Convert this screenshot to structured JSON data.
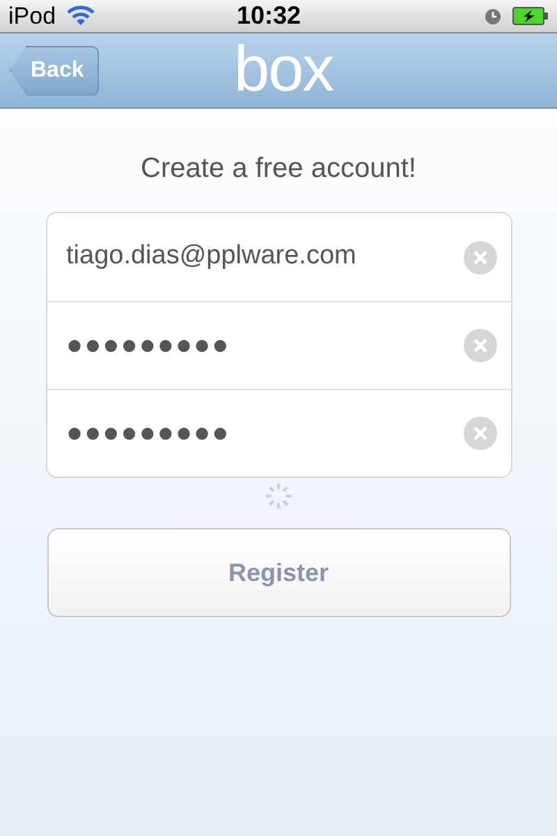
{
  "status_bar": {
    "carrier": "iPod",
    "time": "10:32"
  },
  "nav_bar": {
    "back": "Back",
    "logo": "box"
  },
  "heading": "Create a free account!",
  "fields": [
    {
      "value": "tiago.dias@pplware.com"
    },
    {
      "value": "●●●●●●●●●"
    },
    {
      "value": "●●●●●●●●●"
    }
  ],
  "register_button": "Register"
}
